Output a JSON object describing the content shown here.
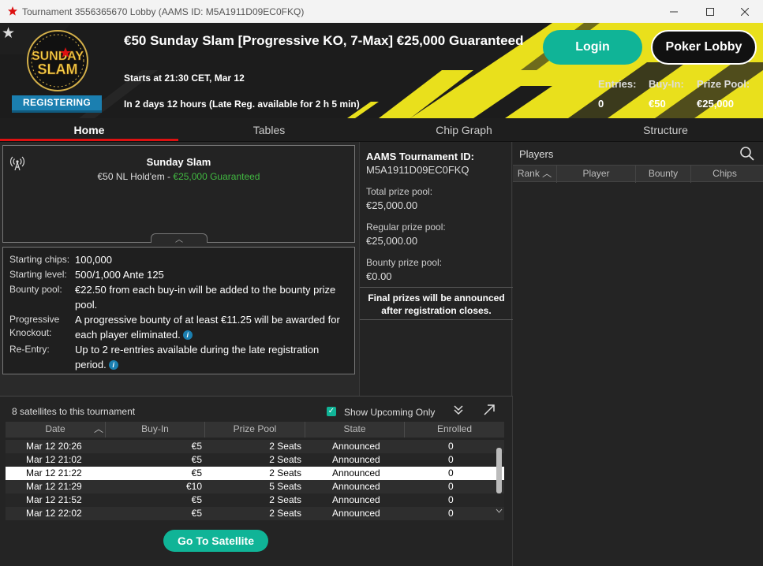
{
  "window": {
    "title": "Tournament 3556365670 Lobby (AAMS ID: M5A1911D09EC0FKQ)"
  },
  "header": {
    "logo_text": "SUNDAY SLAM",
    "status_badge": "REGISTERING",
    "tournament_name": "€50 Sunday Slam [Progressive KO, 7-Max] €25,000 Guaranteed",
    "starts": "Starts at 21:30 CET, Mar 12",
    "remaining": "In 2 days 12 hours (Late Reg. available for 2 h 5 min)",
    "login_label": "Login",
    "lobby_label": "Poker Lobby",
    "entries_label": "Entries:",
    "entries_value": "0",
    "buyin_label": "Buy-In:",
    "buyin_value": "€50",
    "prizepool_label": "Prize Pool:",
    "prizepool_value": "€25,000"
  },
  "tabs": [
    {
      "label": "Home",
      "active": true
    },
    {
      "label": "Tables",
      "active": false
    },
    {
      "label": "Chip Graph",
      "active": false
    },
    {
      "label": "Structure",
      "active": false
    }
  ],
  "info_card": {
    "name": "Sunday Slam",
    "game": "€50 NL Hold'em - ",
    "guarantee": "€25,000 Guaranteed"
  },
  "details": [
    {
      "label": "Starting chips:",
      "value": "100,000",
      "info": false
    },
    {
      "label": "Starting level:",
      "value": "500/1,000 Ante 125",
      "info": false
    },
    {
      "label": "Bounty pool:",
      "value": "€22.50 from each buy-in will be added to the bounty prize pool.",
      "info": false
    },
    {
      "label": "Progressive Knockout:",
      "value": "A progressive bounty of at least €11.25 will be awarded for each player eliminated.",
      "info": true
    },
    {
      "label": "Re-Entry:",
      "value": "Up to 2 re-entries available during the late registration period.",
      "info": true
    }
  ],
  "aams": {
    "title": "AAMS Tournament ID:",
    "id": "M5A1911D09EC0FKQ",
    "total_label": "Total prize pool:",
    "total_value": "€25,000.00",
    "regular_label": "Regular prize pool:",
    "regular_value": "€25,000.00",
    "bounty_label": "Bounty prize pool:",
    "bounty_value": "€0.00",
    "note": "Final prizes will be announced after registration closes."
  },
  "players": {
    "title": "Players",
    "columns": [
      "Rank",
      "Player",
      "Bounty",
      "Chips"
    ]
  },
  "satellites": {
    "title": "8 satellites to this tournament",
    "show_upcoming_label": "Show Upcoming Only",
    "show_upcoming_checked": true,
    "columns": [
      "Date",
      "Buy-In",
      "Prize Pool",
      "State",
      "Enrolled"
    ],
    "rows": [
      {
        "date": "Mar 12  20:26",
        "buyin": "€5",
        "prize": "2 Seats",
        "state": "Announced",
        "enrolled": "0"
      },
      {
        "date": "Mar 12  21:02",
        "buyin": "€5",
        "prize": "2 Seats",
        "state": "Announced",
        "enrolled": "0"
      },
      {
        "date": "Mar 12  21:22",
        "buyin": "€5",
        "prize": "2 Seats",
        "state": "Announced",
        "enrolled": "0",
        "selected": true
      },
      {
        "date": "Mar 12  21:29",
        "buyin": "€10",
        "prize": "5 Seats",
        "state": "Announced",
        "enrolled": "0"
      },
      {
        "date": "Mar 12  21:52",
        "buyin": "€5",
        "prize": "2 Seats",
        "state": "Announced",
        "enrolled": "0"
      },
      {
        "date": "Mar 12  22:02",
        "buyin": "€5",
        "prize": "2 Seats",
        "state": "Announced",
        "enrolled": "0"
      }
    ],
    "go_label": "Go To Satellite"
  },
  "colors": {
    "accent_green": "#10b497",
    "badge_blue": "#1b7fb0",
    "active_tab_red": "#dd1111",
    "guarantee_green": "#41b941",
    "header_yellow": "#e9e01c"
  }
}
